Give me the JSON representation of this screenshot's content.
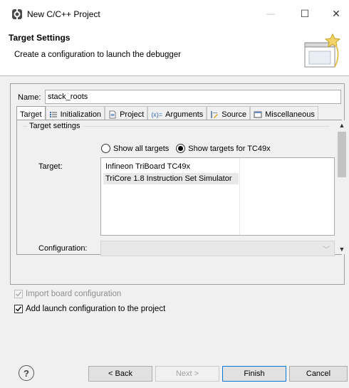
{
  "window": {
    "title": "New C/C++ Project",
    "icon": "eclipse-app-icon",
    "minimize": "—",
    "maximize": "☐",
    "close": "✕"
  },
  "banner": {
    "title": "Target Settings",
    "description": "Create a configuration to launch the debugger"
  },
  "launch_config": {
    "name_label": "Name:",
    "name_value": "stack_roots"
  },
  "tabs": [
    {
      "label": "Target",
      "icon": "target-icon",
      "active": true
    },
    {
      "label": "Initialization",
      "icon": "list-icon",
      "active": false
    },
    {
      "label": "Project",
      "icon": "project-icon",
      "active": false
    },
    {
      "label": "Arguments",
      "icon": "arguments-icon",
      "active": false
    },
    {
      "label": "Source",
      "icon": "source-icon",
      "active": false
    },
    {
      "label": "Miscellaneous",
      "icon": "misc-icon",
      "active": false
    }
  ],
  "target_settings": {
    "group_label": "Target settings",
    "show_all_label": "Show all targets",
    "show_for_label": "Show targets for TC49x",
    "selected_radio": "show_for",
    "target_label": "Target:",
    "targets": [
      "Infineon TriBoard TC49x",
      "TriCore 1.8 Instruction Set Simulator"
    ],
    "selected_target_index": 1,
    "configuration_label": "Configuration:",
    "configuration_value": ""
  },
  "options": {
    "import_board_label": "Import board configuration",
    "import_board_checked": true,
    "import_board_enabled": false,
    "add_launch_label": "Add launch configuration to the project",
    "add_launch_checked": true
  },
  "buttons": {
    "help": "?",
    "back": "< Back",
    "next": "Next >",
    "finish": "Finish",
    "cancel": "Cancel"
  }
}
